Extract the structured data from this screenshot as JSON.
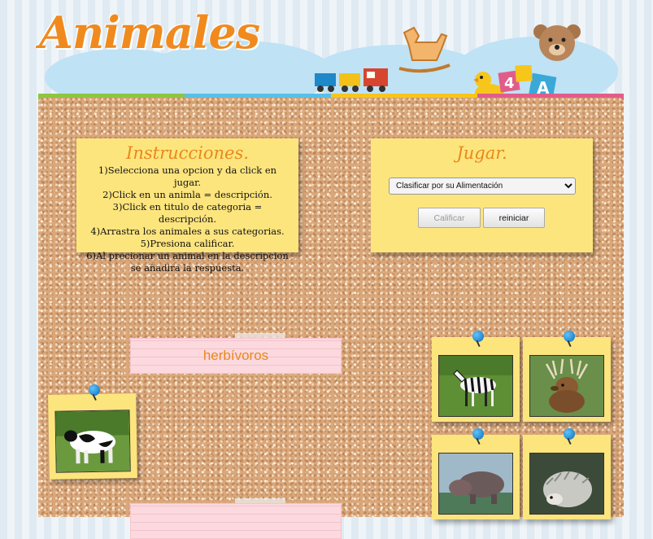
{
  "app": {
    "logo_text": "Animales"
  },
  "instructions": {
    "title": "Instrucciones.",
    "steps": [
      "1)Selecciona una opcion y da click en jugar.",
      "2)Click en un animla = descripción.",
      "3)Click en titulo de categoria = descripción.",
      "4)Arrastra los animales a sus categorias.",
      "5)Presiona calificar.",
      "6)Al precionar un animal en la descripcion se añadira la respuesta."
    ]
  },
  "game": {
    "title": "Jugar.",
    "select_value": "Clasificar por su Alimentación",
    "grade_button": "Calificar",
    "reset_button": "reiniciar"
  },
  "categories": [
    "herbívoros"
  ],
  "animals": [
    "cow",
    "zebra",
    "deer",
    "hippo",
    "opossum"
  ],
  "colors": {
    "accent": "#e9881b",
    "note": "#fde57e",
    "category": "#fcd9df",
    "pin": "#0a6db4"
  }
}
